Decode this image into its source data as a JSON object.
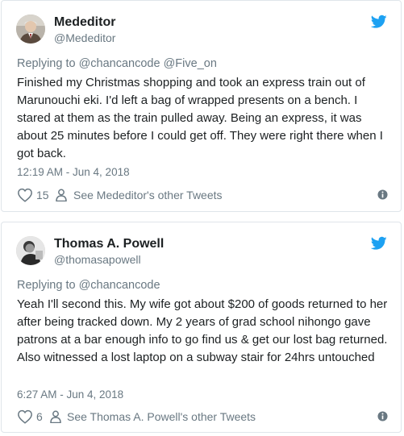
{
  "tweets": [
    {
      "author_name": "Mededitor",
      "author_handle": "@Mededitor",
      "replying_to_label": "Replying to",
      "replying_to_mentions": "@chancancode @Five_on",
      "text": "Finished my Christmas shopping and took an express train out of Marunouchi eki. I'd left a bag of wrapped presents on a bench. I stared at them as the train pulled away. Being an express, it was about 25 minutes before I could get off. They were right there when I got back.",
      "timestamp": "12:19 AM - Jun 4, 2018",
      "likes": "15",
      "other_tweets_link": "See Mededitor's other Tweets",
      "icons": {
        "brand": "twitter-bird-icon",
        "like": "heart-icon",
        "profile": "person-icon",
        "info": "info-icon"
      }
    },
    {
      "author_name": "Thomas A. Powell",
      "author_handle": "@thomasapowell",
      "replying_to_label": "Replying to",
      "replying_to_mentions": "@chancancode",
      "text": "Yeah I'll second this.  My wife got about $200 of goods returned to her after being tracked down. My 2 years of grad school nihongo gave patrons at a bar enough info to go find us & get our lost bag returned.  Also witnessed a lost laptop on a subway stair for 24hrs untouched",
      "timestamp": "6:27 AM - Jun 4, 2018",
      "likes": "6",
      "other_tweets_link": "See Thomas A. Powell's other Tweets",
      "icons": {
        "brand": "twitter-bird-icon",
        "like": "heart-icon",
        "profile": "person-icon",
        "info": "info-icon"
      }
    }
  ],
  "colors": {
    "twitter_blue": "#1da1f2",
    "text_primary": "#1c2022",
    "text_secondary": "#697882",
    "border": "#dfe5ea"
  }
}
